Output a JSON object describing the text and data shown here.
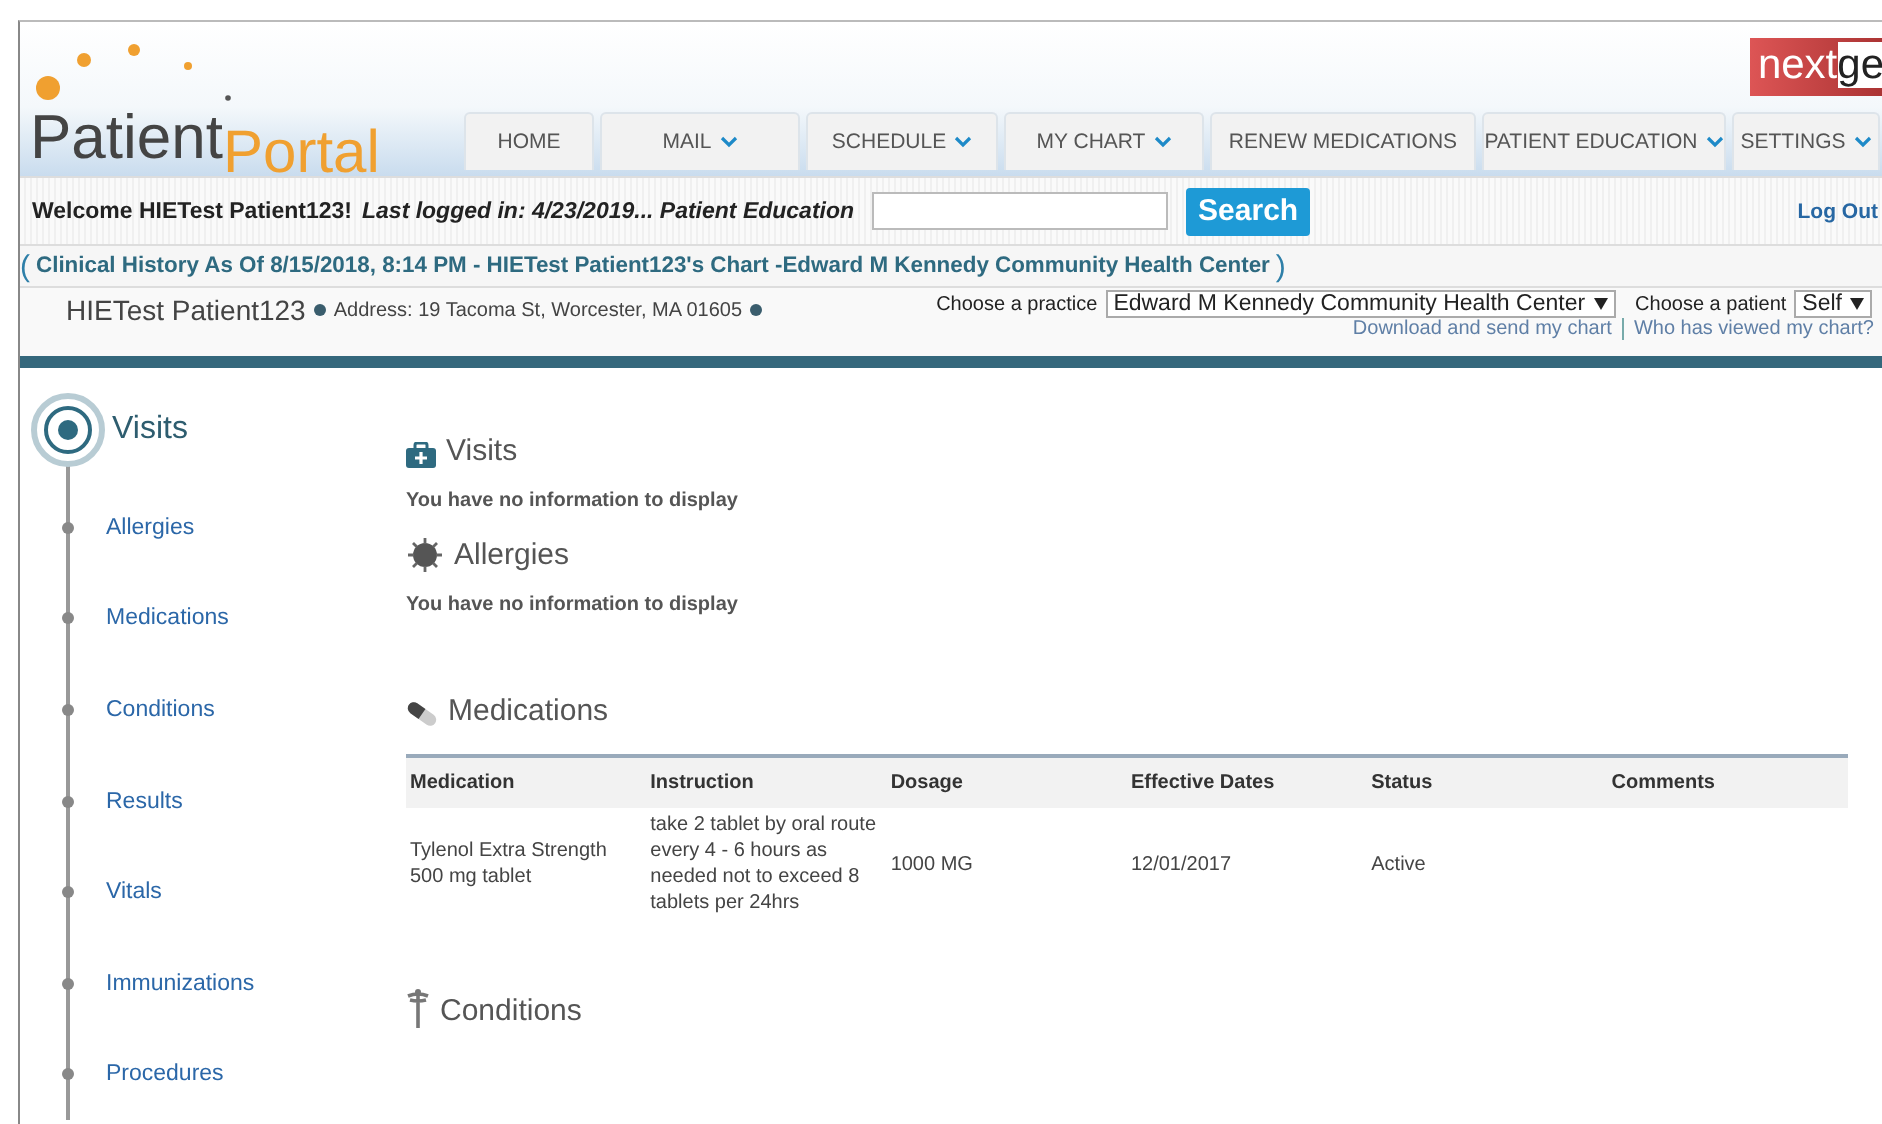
{
  "header": {
    "logo": {
      "word_1": "Patient",
      "word_2": "Portal"
    },
    "partner_logo": {
      "text_1": "next",
      "text_2": "ge"
    },
    "nav": [
      {
        "label": "HOME",
        "dropdown": false
      },
      {
        "label": "MAIL",
        "dropdown": true
      },
      {
        "label": "SCHEDULE",
        "dropdown": true
      },
      {
        "label": "MY CHART",
        "dropdown": true
      },
      {
        "label": "RENEW MEDICATIONS",
        "dropdown": false
      },
      {
        "label": "PATIENT EDUCATION",
        "dropdown": true
      },
      {
        "label": "SETTINGS",
        "dropdown": true
      }
    ]
  },
  "welcome_bar": {
    "welcome": "Welcome HIETest Patient123!",
    "last_login": "Last logged in: 4/23/2019... Patient Education",
    "search_button": "Search",
    "logout": "Log Out"
  },
  "chart_title": {
    "open": "(",
    "text": "Clinical History As Of 8/15/2018, 8:14 PM - HIETest Patient123's Chart -Edward M Kennedy Community Health Center",
    "close": ")"
  },
  "patient_bar": {
    "name": "HIETest Patient123",
    "address": "Address: 19 Tacoma St, Worcester, MA 01605",
    "practice_label": "Choose a practice",
    "practice": "Edward M Kennedy Community Health Center",
    "patient_label": "Choose a patient",
    "patient": "Self",
    "link_1": "Download and send my chart",
    "link_2": "Who has viewed my chart?"
  },
  "sidebar": {
    "items": [
      {
        "label": "Visits",
        "selected": true
      },
      {
        "label": "Allergies",
        "selected": false
      },
      {
        "label": "Medications",
        "selected": false
      },
      {
        "label": "Conditions",
        "selected": false
      },
      {
        "label": "Results",
        "selected": false
      },
      {
        "label": "Vitals",
        "selected": false
      },
      {
        "label": "Immunizations",
        "selected": false
      },
      {
        "label": "Procedures",
        "selected": false
      }
    ]
  },
  "sections": [
    {
      "title": "Visits",
      "kind": "empty",
      "message": "You have no information to display"
    },
    {
      "title": "Allergies",
      "kind": "empty",
      "message": "You have no information to display"
    },
    {
      "title": "Medications",
      "kind": "table",
      "table": {
        "columns": [
          "Medication",
          "Instruction",
          "Dosage",
          "Effective Dates",
          "Status",
          "Comments"
        ],
        "rows": [
          [
            "Tylenol Extra Strength 500 mg tablet",
            "take 2 tablet by oral route every 4 - 6 hours as needed not to exceed 8 tablets per 24hrs",
            "1000 MG",
            "12/01/2017",
            "Active",
            ""
          ]
        ]
      }
    },
    {
      "title": "Conditions",
      "kind": "heading"
    }
  ]
}
